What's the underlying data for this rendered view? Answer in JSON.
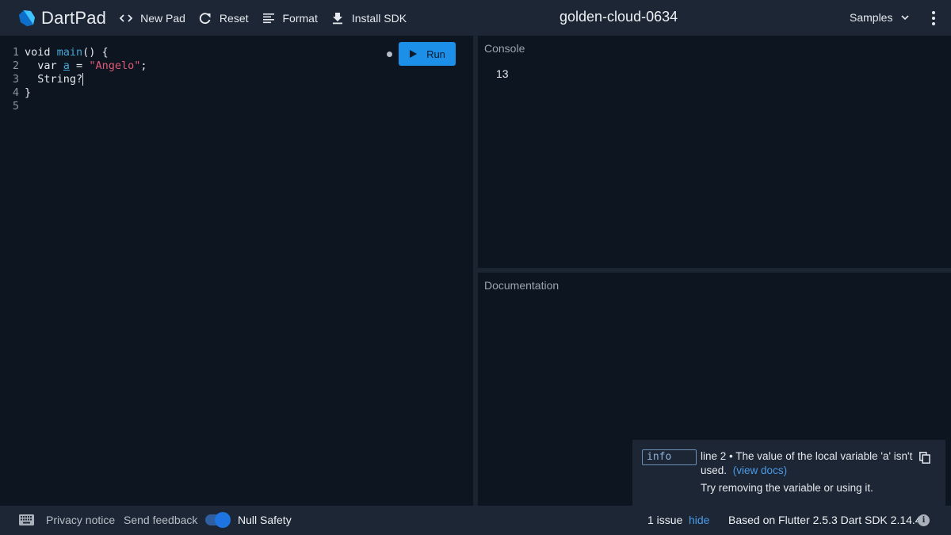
{
  "header": {
    "app_name": "DartPad",
    "buttons": [
      {
        "label": "New Pad",
        "icon": "code-brackets-icon"
      },
      {
        "label": "Reset",
        "icon": "refresh-icon"
      },
      {
        "label": "Format",
        "icon": "format-lines-icon"
      },
      {
        "label": "Install SDK",
        "icon": "download-icon"
      }
    ],
    "pad_title": "golden-cloud-0634",
    "samples_label": "Samples",
    "more_icon": "more-vert-icon"
  },
  "editor": {
    "line_numbers": [
      "1",
      "2",
      "3",
      "4",
      "5"
    ],
    "lines": {
      "l1_kw": "void ",
      "l1_fn": "main",
      "l1_rest": "() {",
      "l2_kw": "  var ",
      "l2_var": "a",
      "l2_eq": " = ",
      "l2_str": "\"Angelo\"",
      "l2_end": ";",
      "l3": "  String?",
      "l4": "}",
      "l5": ""
    },
    "run_label": "Run"
  },
  "console": {
    "label": "Console",
    "output": "13"
  },
  "documentation": {
    "label": "Documentation"
  },
  "issue": {
    "type": "info",
    "message": "line 2 • The value of the local variable 'a' isn't used.",
    "link": "(view docs)",
    "fix": "Try removing the variable or using it."
  },
  "footer": {
    "privacy": "Privacy notice",
    "feedback": "Send feedback",
    "null_safety_label": "Null Safety",
    "null_safety_on": true,
    "issues_count": "1 issue",
    "hide_label": "hide",
    "sdk_info": "Based on Flutter 2.5.3 Dart SDK 2.14.4"
  },
  "colors": {
    "accent": "#1c8fe8",
    "link": "#4a9be8",
    "string": "#e05a74",
    "identifier": "#43a6d6"
  }
}
